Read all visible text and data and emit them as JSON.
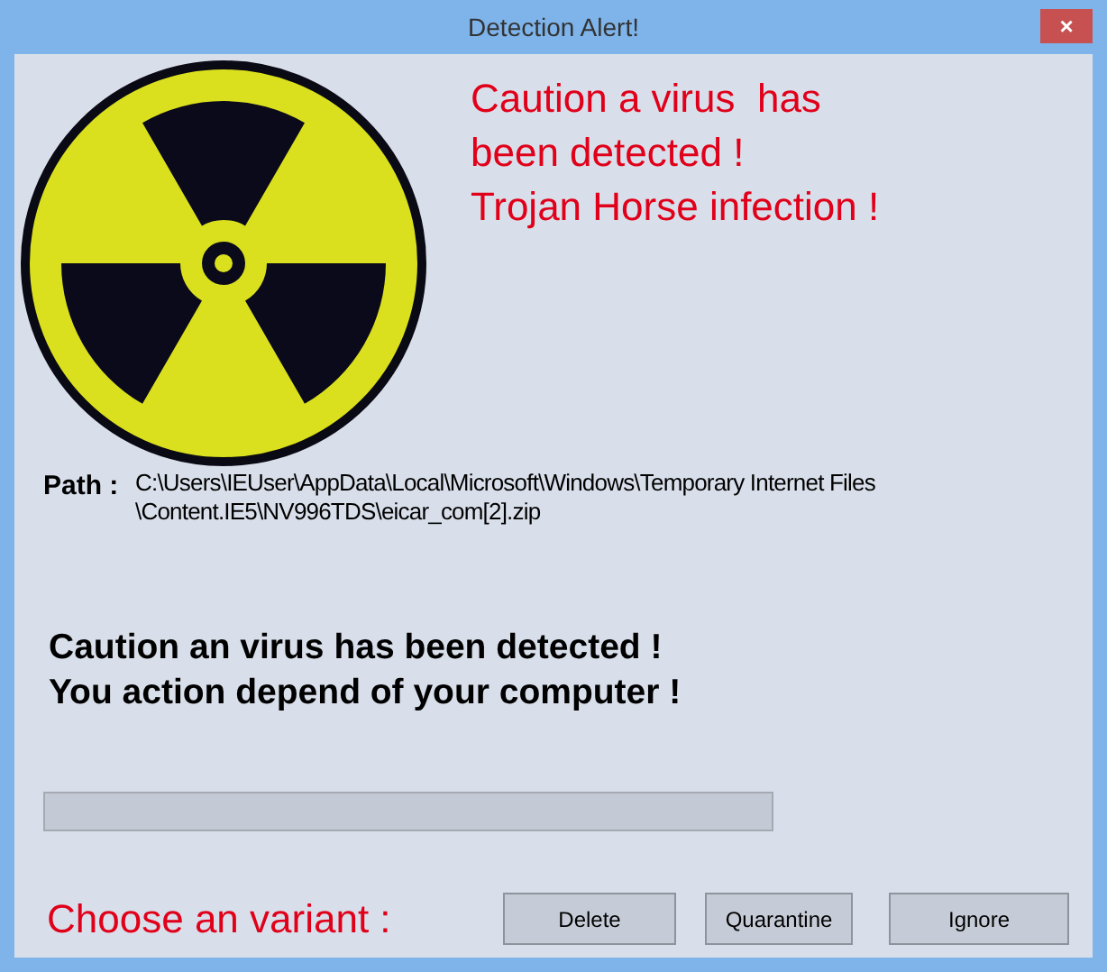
{
  "window": {
    "title": "Detection Alert!",
    "close_glyph": "×"
  },
  "headline": [
    "Caution a virus  has",
    "been detected !",
    "Trojan Horse infection !"
  ],
  "path": {
    "label": "Path :",
    "value": [
      "C:\\Users\\IEUser\\AppData\\Local\\Microsoft\\Windows\\Temporary Internet Files",
      "\\Content.IE5\\NV996TDS\\eicar_com[2].zip"
    ]
  },
  "message": [
    "Caution an virus has been detected !",
    "You action depend of your computer !"
  ],
  "progress": {
    "level": 0
  },
  "prompt": "Choose an variant :",
  "buttons": [
    "Delete",
    "Quarantine",
    "Ignore"
  ]
}
